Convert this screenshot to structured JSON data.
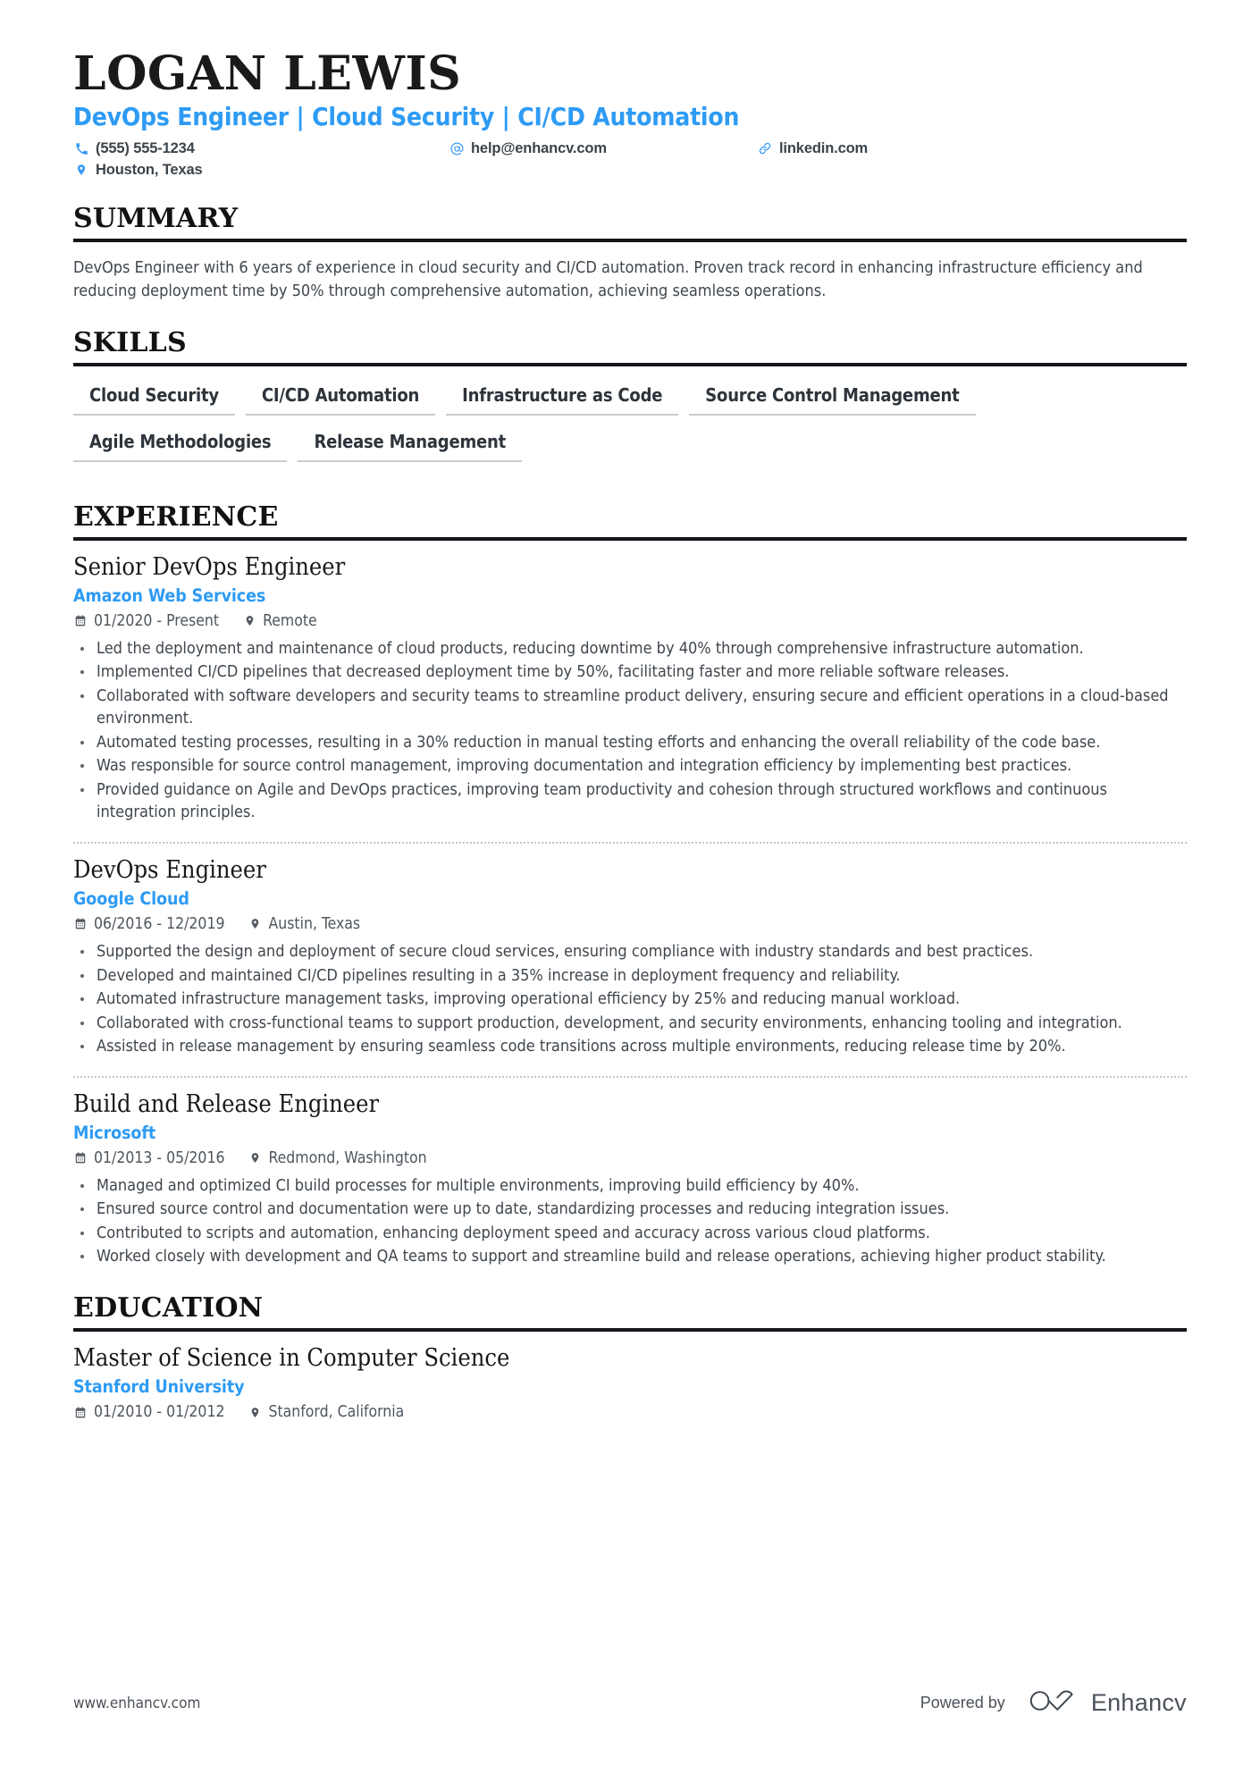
{
  "header": {
    "name": "LOGAN LEWIS",
    "headline": "DevOps Engineer | Cloud Security | CI/CD Automation",
    "contacts": {
      "phone": "(555) 555-1234",
      "email": "help@enhancv.com",
      "website": "linkedin.com",
      "location": "Houston, Texas"
    },
    "icons": {
      "phone": "phone-icon",
      "email": "at-sign-icon",
      "website": "link-icon",
      "location": "map-pin-icon"
    }
  },
  "sections": {
    "summary": {
      "title": "SUMMARY",
      "text": "DevOps Engineer with 6 years of experience in cloud security and CI/CD automation. Proven track record in enhancing infrastructure efficiency and reducing deployment time by 50% through comprehensive automation, achieving seamless operations."
    },
    "skills": {
      "title": "SKILLS",
      "items": [
        "Cloud Security",
        "CI/CD Automation",
        "Infrastructure as Code",
        "Source Control Management",
        "Agile Methodologies",
        "Release Management"
      ]
    },
    "experience": {
      "title": "EXPERIENCE",
      "entries": [
        {
          "title": "Senior DevOps Engineer",
          "org": "Amazon Web Services",
          "dates": "01/2020 - Present",
          "location": "Remote",
          "bullets": [
            "Led the deployment and maintenance of cloud products, reducing downtime by 40% through comprehensive infrastructure automation.",
            "Implemented CI/CD pipelines that decreased deployment time by 50%, facilitating faster and more reliable software releases.",
            "Collaborated with software developers and security teams to streamline product delivery, ensuring secure and efficient operations in a cloud-based environment.",
            "Automated testing processes, resulting in a 30% reduction in manual testing efforts and enhancing the overall reliability of the code base.",
            "Was responsible for source control management, improving documentation and integration efficiency by implementing best practices.",
            "Provided guidance on Agile and DevOps practices, improving team productivity and cohesion through structured workflows and continuous integration principles."
          ]
        },
        {
          "title": "DevOps Engineer",
          "org": "Google Cloud",
          "dates": "06/2016 - 12/2019",
          "location": "Austin, Texas",
          "bullets": [
            "Supported the design and deployment of secure cloud services, ensuring compliance with industry standards and best practices.",
            "Developed and maintained CI/CD pipelines resulting in a 35% increase in deployment frequency and reliability.",
            "Automated infrastructure management tasks, improving operational efficiency by 25% and reducing manual workload.",
            "Collaborated with cross-functional teams to support production, development, and security environments, enhancing tooling and integration.",
            "Assisted in release management by ensuring seamless code transitions across multiple environments, reducing release time by 20%."
          ]
        },
        {
          "title": "Build and Release Engineer",
          "org": "Microsoft",
          "dates": "01/2013 - 05/2016",
          "location": "Redmond, Washington",
          "bullets": [
            "Managed and optimized CI build processes for multiple environments, improving build efficiency by 40%.",
            "Ensured source control and documentation were up to date, standardizing processes and reducing integration issues.",
            "Contributed to scripts and automation, enhancing deployment speed and accuracy across various cloud platforms.",
            "Worked closely with development and QA teams to support and streamline build and release operations, achieving higher product stability."
          ]
        }
      ]
    },
    "education": {
      "title": "EDUCATION",
      "entries": [
        {
          "title": "Master of Science in Computer Science",
          "org": "Stanford University",
          "dates": "01/2010 - 01/2012",
          "location": "Stanford, California"
        }
      ]
    }
  },
  "footer": {
    "url": "www.enhancv.com",
    "powered_by": "Powered by",
    "brand": "Enhancv"
  },
  "colors": {
    "accent": "#2e9bf4",
    "rule": "#13171b",
    "text": "#3f464d"
  }
}
